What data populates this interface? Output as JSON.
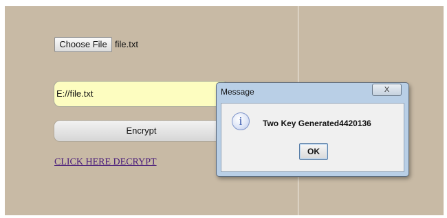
{
  "form": {
    "choose_file_label": "Choose File",
    "file_name": "file.txt",
    "path_value": "E://file.txt",
    "encrypt_label": "Encrypt",
    "decrypt_link": "CLICK HERE DECRYPT"
  },
  "dialog": {
    "title": "Message",
    "close_glyph": "X",
    "icon": "info-icon",
    "icon_glyph": "i",
    "message": "Two Key Generated4420136",
    "ok_label": "OK"
  },
  "colors": {
    "page_background": "#c8baa5",
    "input_background": "#fdfdc0",
    "dialog_frame": "#b9cfe6",
    "link": "#4a1d7a"
  }
}
